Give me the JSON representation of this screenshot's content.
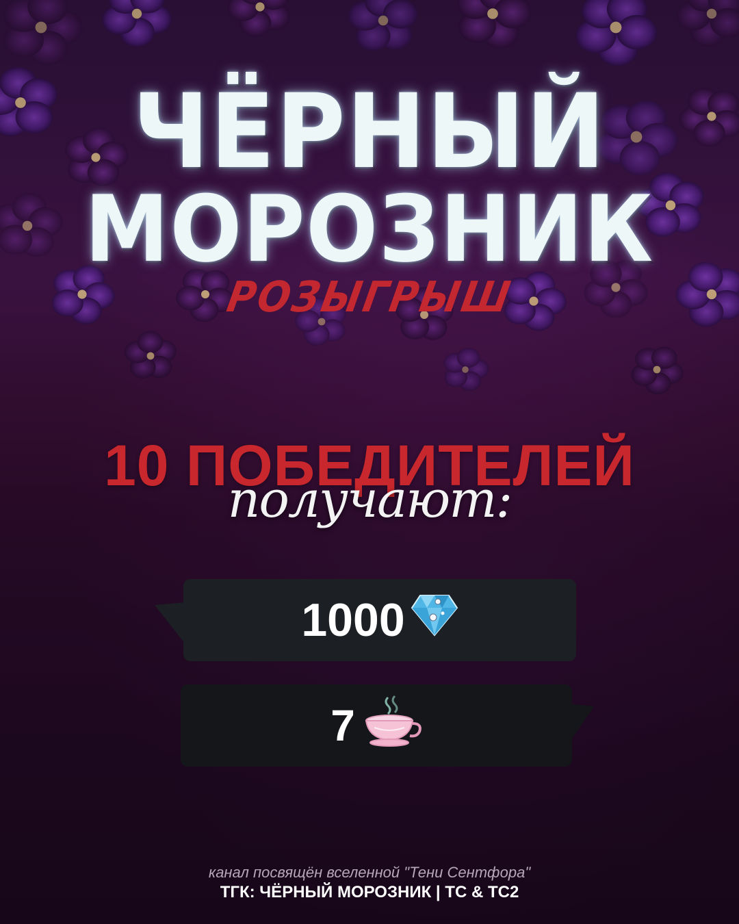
{
  "title": {
    "line1": "ЧЁРНЫЙ",
    "line2": "МОРОЗНИК",
    "subtitle": "РОЗЫГРЫШ"
  },
  "winners": {
    "heading": "10 ПОБЕДИТЕЛЕЙ",
    "receive": "получают:"
  },
  "prizes": [
    {
      "amount": "1000",
      "icon": "diamond-icon"
    },
    {
      "amount": "7",
      "icon": "teacup-icon"
    }
  ],
  "footer": {
    "line1": "канал посвящён вселенной \"Тени Сентфора\"",
    "line2": "ТГК: ЧЁРНЫЙ МОРОЗНИК | ТС & ТС2"
  },
  "colors": {
    "title": "#eef7f8",
    "accent_red": "#c8282d",
    "prize_bg": "#1c1f24",
    "background": "#2a0f2c"
  }
}
